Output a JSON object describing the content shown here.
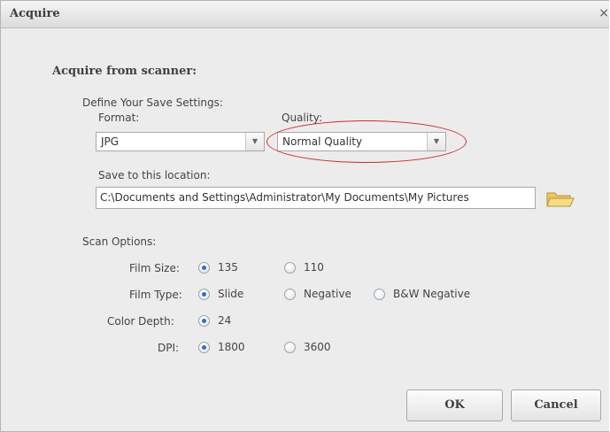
{
  "window": {
    "title": "Acquire",
    "close_glyph": "×"
  },
  "heading": "Acquire from scanner:",
  "save_settings": {
    "section_label": "Define Your Save Settings:",
    "format_label": "Format:",
    "format_value": "JPG",
    "quality_label": "Quality:",
    "quality_value": "Normal Quality",
    "location_label": "Save to this location:",
    "location_value": "C:\\Documents and Settings\\Administrator\\My Documents\\My Pictures"
  },
  "scan_options": {
    "section_label": "Scan Options:",
    "film_size": {
      "label": "Film Size:",
      "options": [
        "135",
        "110"
      ],
      "selected": "135"
    },
    "film_type": {
      "label": "Film Type:",
      "options": [
        "Slide",
        "Negative",
        "B&W Negative"
      ],
      "selected": "Slide"
    },
    "color_depth": {
      "label": "Color Depth:",
      "options": [
        "24"
      ],
      "selected": "24"
    },
    "dpi": {
      "label": "DPI:",
      "options": [
        "1800",
        "3600"
      ],
      "selected": "1800"
    }
  },
  "buttons": {
    "ok": "OK",
    "cancel": "Cancel"
  },
  "colors": {
    "annotation": "#cc2b2b",
    "radio_accent": "#2f6fc4"
  }
}
